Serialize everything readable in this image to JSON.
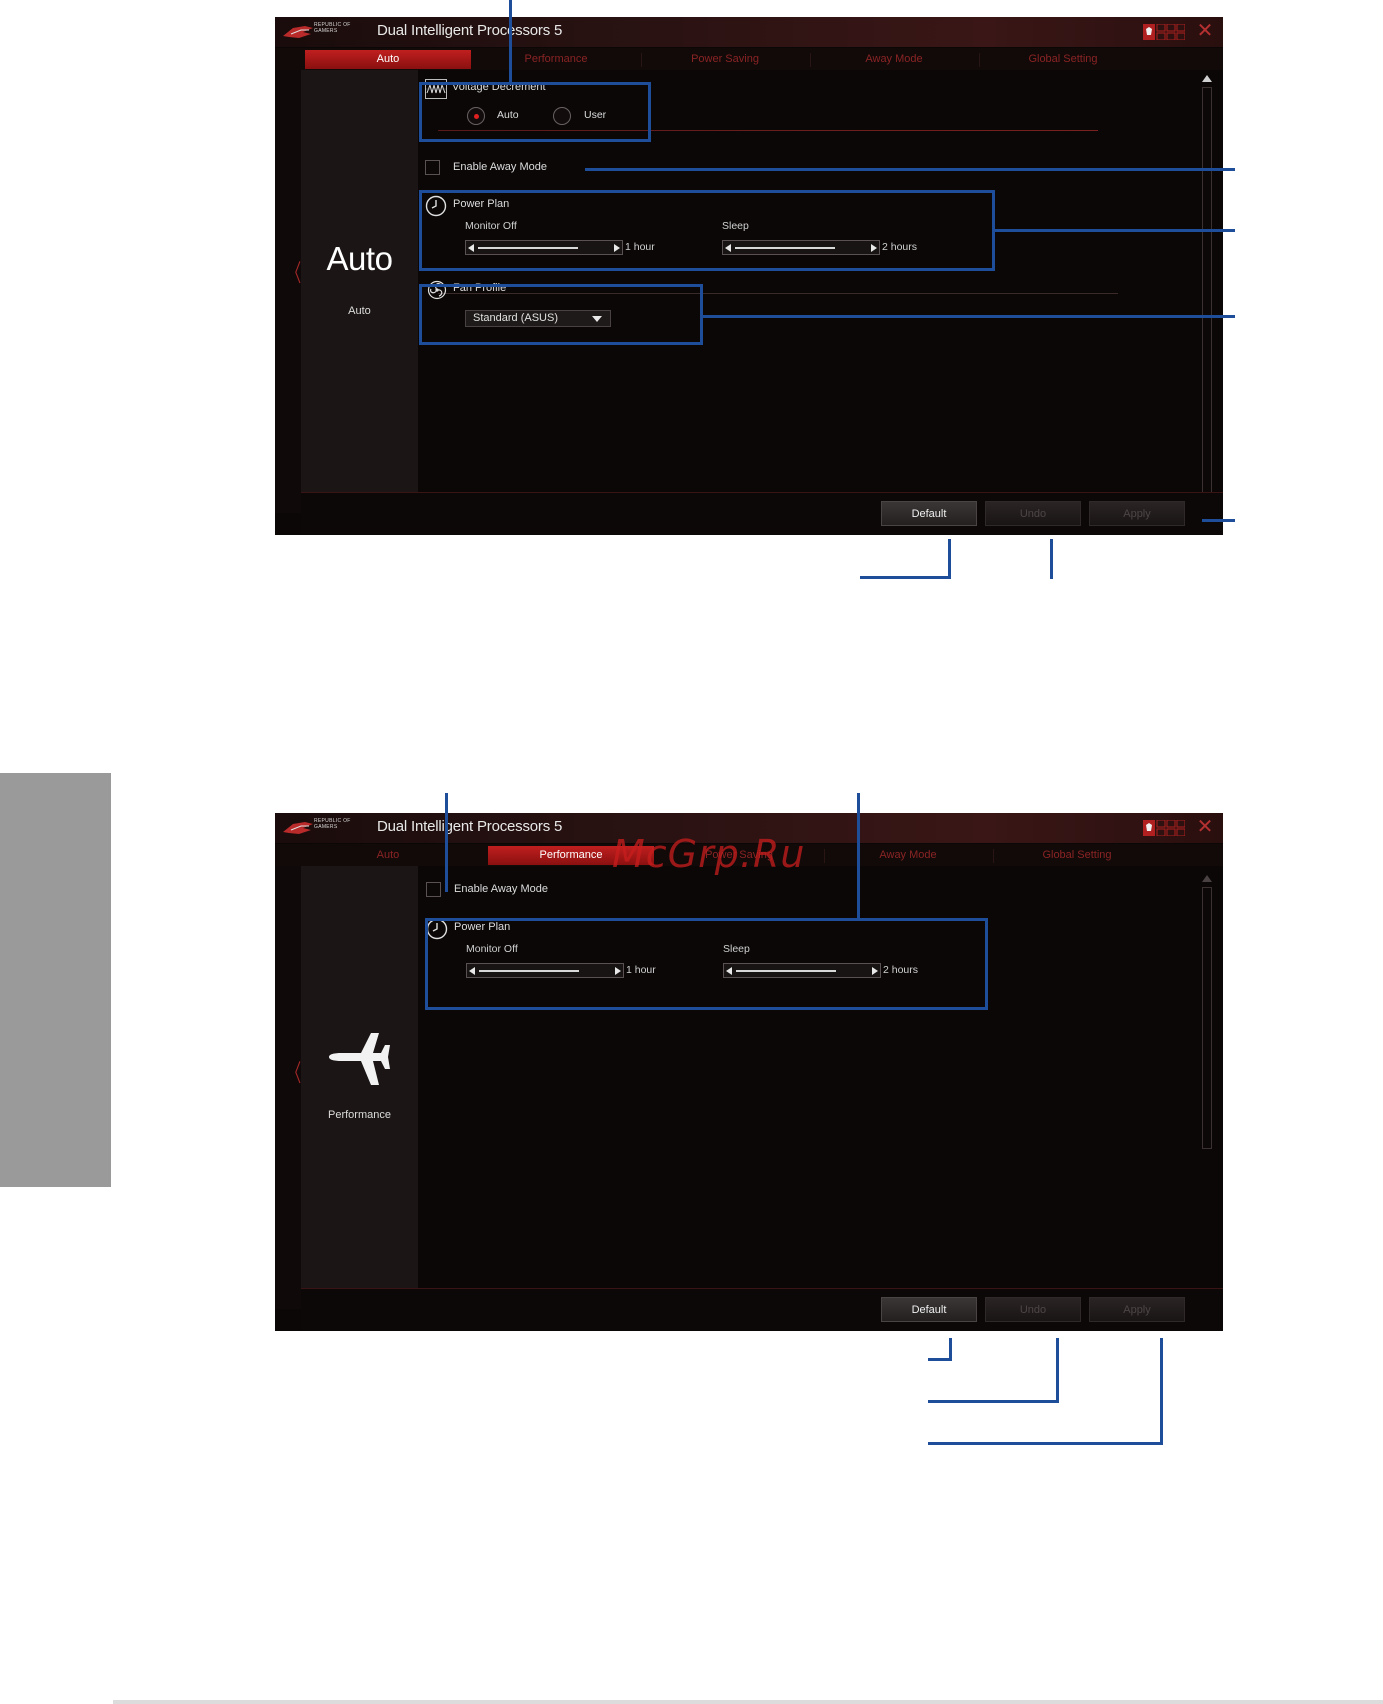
{
  "app": {
    "title": "Dual Intelligent Processors 5",
    "logo_text_line1": "REPUBLIC OF",
    "logo_text_line2": "GAMERS"
  },
  "tabs": [
    "Auto",
    "Performance",
    "Power Saving",
    "Away Mode",
    "Global Setting"
  ],
  "colors": {
    "accent": "#c01f1f",
    "callout": "#1e4e9a",
    "background": "#0b0707"
  },
  "screen1": {
    "active_tab": "Auto",
    "mode_title": "Auto",
    "mode_subtitle": "Auto",
    "voltage": {
      "label": "Voltage Decrement",
      "options": [
        "Auto",
        "User"
      ],
      "selected": "Auto"
    },
    "away_mode_label": "Enable Away Mode",
    "power_plan": {
      "label": "Power Plan",
      "monitor_off_label": "Monitor Off",
      "monitor_off_value": "1 hour",
      "sleep_label": "Sleep",
      "sleep_value": "2 hours"
    },
    "fan_profile": {
      "label": "Fan Profile",
      "selected": "Standard (ASUS)"
    },
    "buttons": {
      "default": "Default",
      "undo": "Undo",
      "apply": "Apply"
    }
  },
  "screen2": {
    "active_tab": "Performance",
    "mode_subtitle": "Performance",
    "away_mode_label": "Enable Away Mode",
    "power_plan": {
      "label": "Power Plan",
      "monitor_off_label": "Monitor Off",
      "monitor_off_value": "1 hour",
      "sleep_label": "Sleep",
      "sleep_value": "2 hours"
    },
    "buttons": {
      "default": "Default",
      "undo": "Undo",
      "apply": "Apply"
    }
  },
  "watermark": "McGrp.Ru"
}
